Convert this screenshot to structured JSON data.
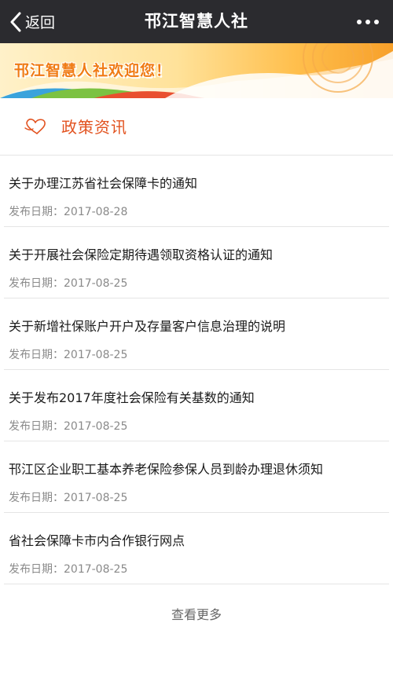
{
  "navbar": {
    "back_label": "返回",
    "title": "邗江智慧人社"
  },
  "banner": {
    "text": "邗江智慧人社欢迎您！"
  },
  "section": {
    "title": "政策资讯",
    "accent_color": "#e2521f"
  },
  "news": [
    {
      "title": "关于办理江苏省社会保障卡的通知",
      "date": "发布日期：2017-08-28"
    },
    {
      "title": "关于开展社会保险定期待遇领取资格认证的通知",
      "date": "发布日期：2017-08-25"
    },
    {
      "title": "关于新增社保账户开户及存量客户信息治理的说明",
      "date": "发布日期：2017-08-25"
    },
    {
      "title": "关于发布2017年度社会保险有关基数的通知",
      "date": "发布日期：2017-08-25"
    },
    {
      "title": "邗江区企业职工基本养老保险参保人员到龄办理退休须知",
      "date": "发布日期：2017-08-25"
    },
    {
      "title": "省社会保障卡市内合作银行网点",
      "date": "发布日期：2017-08-25"
    }
  ],
  "load_more_label": "查看更多"
}
